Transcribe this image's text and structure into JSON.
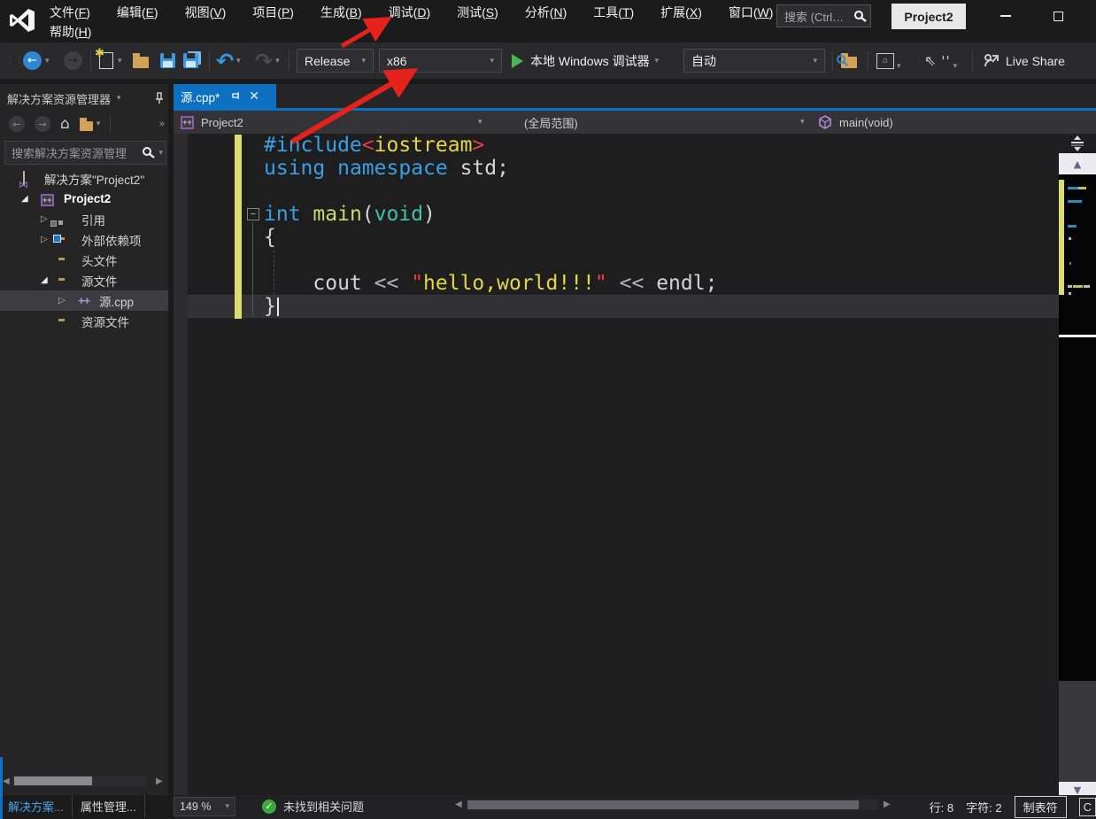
{
  "titlebar": {
    "menu_row1": [
      "文件(F)",
      "编辑(E)",
      "视图(V)",
      "项目(P)",
      "生成(B)",
      "调试(D)",
      "测试(S)",
      "分析(N)",
      "工具(T)",
      "扩展(X)",
      "窗口(W)"
    ],
    "menu_row2": [
      "帮助(H)"
    ],
    "search_placeholder": "搜索 (Ctrl…",
    "project_button": "Project2"
  },
  "toolbar": {
    "configuration": "Release",
    "platform": "x86",
    "run_label": "本地 Windows 调试器",
    "auto_label": "自动",
    "live_share": "Live Share"
  },
  "solution_explorer": {
    "title": "解决方案资源管理器",
    "search_placeholder": "搜索解决方案资源管理",
    "tree": [
      {
        "label": "解决方案\"Project2\"",
        "icon": "solution",
        "expander": "",
        "level": 0
      },
      {
        "label": "Project2",
        "icon": "project",
        "expander": "expanded",
        "level": 1,
        "bold": true
      },
      {
        "label": "引用",
        "icon": "references",
        "expander": "collapsed",
        "level": 2
      },
      {
        "label": "外部依赖项",
        "icon": "ext-deps",
        "expander": "collapsed",
        "level": 2
      },
      {
        "label": "头文件",
        "icon": "folder",
        "expander": "",
        "level": 2
      },
      {
        "label": "源文件",
        "icon": "folder",
        "expander": "expanded",
        "level": 2
      },
      {
        "label": "源.cpp",
        "icon": "cpp-file",
        "expander": "collapsed",
        "level": 3,
        "selected": true
      },
      {
        "label": "资源文件",
        "icon": "folder",
        "expander": "",
        "level": 2
      }
    ],
    "bottom_tabs": [
      "解决方案...",
      "属性管理..."
    ]
  },
  "editor": {
    "tab_title": "源.cpp*",
    "breadcrumb": {
      "project": "Project2",
      "scope": "(全局范围)",
      "member": "main(void)"
    },
    "code_lines": [
      {
        "tokens": [
          [
            "kw",
            "#include"
          ],
          [
            "red",
            "<"
          ],
          [
            "str",
            "iostream"
          ],
          [
            "red",
            ">"
          ]
        ]
      },
      {
        "tokens": [
          [
            "kw",
            "using"
          ],
          [
            "pl",
            " "
          ],
          [
            "kw",
            "namespace"
          ],
          [
            "pl",
            " std;"
          ]
        ]
      },
      {
        "tokens": []
      },
      {
        "tokens": [
          [
            "kw",
            "int"
          ],
          [
            "pl",
            " "
          ],
          [
            "fn",
            "main"
          ],
          [
            "pl",
            "("
          ],
          [
            "type",
            "void"
          ],
          [
            "pl",
            ")"
          ]
        ]
      },
      {
        "tokens": [
          [
            "pl",
            "{"
          ]
        ]
      },
      {
        "tokens": []
      },
      {
        "tokens": [
          [
            "pl",
            "    cout "
          ],
          [
            "op",
            "<<"
          ],
          [
            "pl",
            " "
          ],
          [
            "red",
            "\""
          ],
          [
            "str",
            "hello,world!!!"
          ],
          [
            "red",
            "\""
          ],
          [
            "pl",
            " "
          ],
          [
            "op",
            "<<"
          ],
          [
            "pl",
            " endl;"
          ]
        ]
      },
      {
        "tokens": [
          [
            "pl",
            "}"
          ]
        ],
        "current": true
      }
    ],
    "zoom_level": "149 %",
    "health_message": "未找到相关问题",
    "status": {
      "line": "行: 8",
      "column": "字符: 2",
      "tabs": "制表符",
      "eol": "C"
    }
  },
  "colors": {
    "accent_blue": "#0e70c1",
    "keyword_blue": "#38a0e8",
    "string_yellow": "#e6d54a",
    "bracket_red": "#e8413c",
    "function_green": "#c9d875",
    "change_bar_yellow": "#dedc6c",
    "arrow_red": "#e5231c",
    "run_green": "#44b853"
  }
}
